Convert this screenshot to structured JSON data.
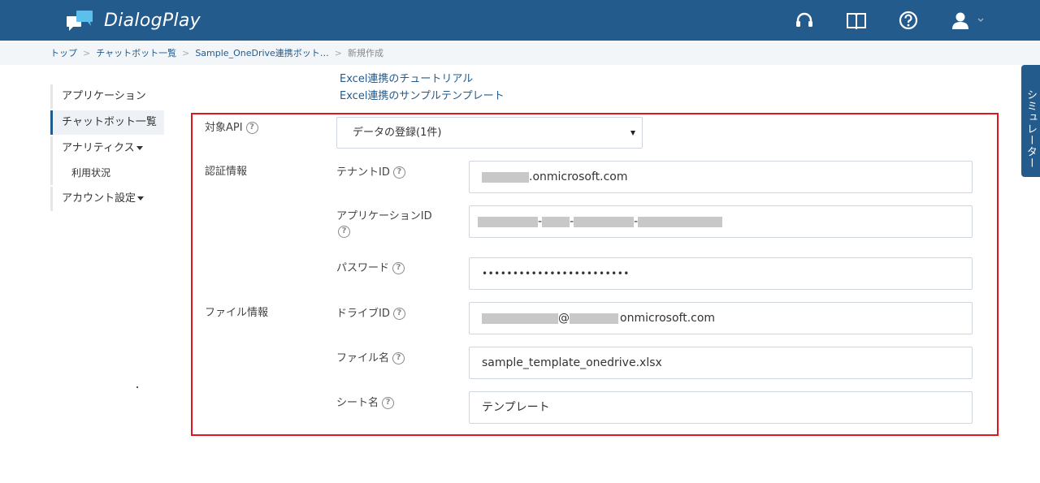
{
  "app": {
    "title": "DialogPlay"
  },
  "breadcrumb": {
    "items": [
      "トップ",
      "チャットボット一覧",
      "Sample_OneDrive連携ボット…"
    ],
    "current": "新規作成",
    "separator": ">"
  },
  "sidebar": {
    "items": [
      {
        "label": "アプリケーション"
      },
      {
        "label": "チャットボット一覧"
      },
      {
        "label": "アナリティクス"
      },
      {
        "label": "利用状況"
      },
      {
        "label": "アカウント設定"
      }
    ]
  },
  "tutorials": [
    "Excel連携のチュートリアル",
    "Excel連携のサンプルテンプレート"
  ],
  "form": {
    "target_api_label": "対象API",
    "target_api_value": "データの登録(1件)",
    "auth_section_label": "認証情報",
    "file_section_label": "ファイル情報",
    "tenant_label": "テナントID",
    "tenant_suffix": ".onmicrosoft.com",
    "app_id_label": "アプリケーションID",
    "app_id_separators": [
      "-",
      "-",
      "-"
    ],
    "password_label": "パスワード",
    "password_value": "••••••••••••••••••••••••",
    "drive_label": "ドライブID",
    "drive_at": "@",
    "drive_suffix": "onmicrosoft.com",
    "file_name_label": "ファイル名",
    "file_name_value": "sample_template_onedrive.xlsx",
    "sheet_name_label": "シート名",
    "sheet_name_value": "テンプレート",
    "help_glyph": "?"
  },
  "simulator": {
    "label": "シミュレーター"
  },
  "colors": {
    "header": "#235b8c",
    "frame": "#e0151f",
    "accent": "#235b8c"
  },
  "icons": [
    "logo-icon",
    "headset-icon",
    "book-icon",
    "help-circle-icon",
    "user-icon",
    "chevron-down-icon"
  ]
}
